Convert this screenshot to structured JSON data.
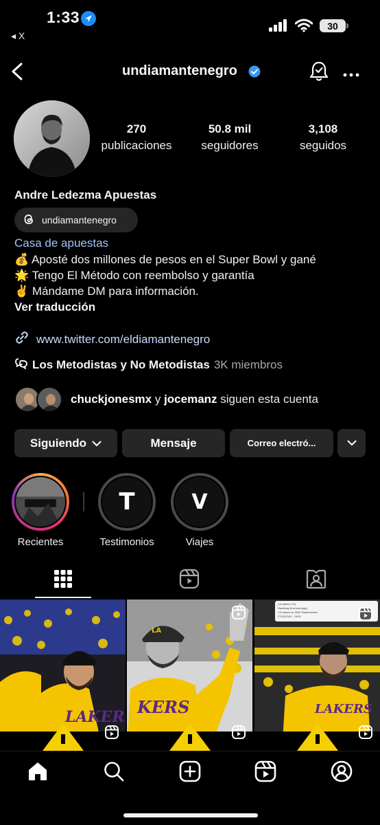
{
  "status_bar": {
    "time": "1:33",
    "back_app": "◂ X",
    "battery": "30"
  },
  "header": {
    "username": "undiamantenegro",
    "verified": true
  },
  "profile": {
    "stats": [
      {
        "value": "270",
        "label": "publicaciones"
      },
      {
        "value": "50.8 mil",
        "label": "seguidores"
      },
      {
        "value": "3,108",
        "label": "seguidos"
      }
    ],
    "full_name": "Andre Ledezma Apuestas",
    "threads_handle": "undiamantenegro",
    "category": "Casa de apuestas",
    "bio_lines": [
      "💰 Aposté dos millones de pesos en el Super Bowl y gané",
      "🌟 Tengo El Método con reembolso y garantía",
      "✌️ Mándame DM para información."
    ],
    "translate": "Ver traducción",
    "link": "www.twitter.com/eldiamantenegro",
    "channel_name": "Los Metodistas y No Metodistas",
    "channel_members": "3K miembros",
    "followed_by_1": "chuckjonesmx",
    "followed_by_and": " y ",
    "followed_by_2": "jocemanz",
    "followed_by_suffix": " siguen esta cuenta"
  },
  "buttons": {
    "following": "Siguiendo",
    "message": "Mensaje",
    "email": "Correo electró..."
  },
  "highlights": [
    {
      "label": "Recientes"
    },
    {
      "label": "Testimonios",
      "letter": "T"
    },
    {
      "label": "Viajes",
      "letter": "V"
    }
  ],
  "posts_grid_overlay_texts": {
    "tile3_caption_1": "LA Lakers (+5)",
    "tile3_caption_2": "Handicap (incl.prorroga)",
    "tile3_caption_3": "LA Lakers vs. MIN Timberwolves",
    "tile3_caption_4": "27/10/2024 · 19:00"
  },
  "colors": {
    "background": "#000000",
    "button_bg": "#262626",
    "link": "#c6dcfc",
    "verified": "#3897f0",
    "lakers_yellow": "#f5d000"
  },
  "icons": {
    "back": "chevron-left-icon",
    "bell": "bell-check-icon",
    "more": "more-horizontal-icon",
    "tabs": [
      "grid-icon",
      "reels-icon",
      "tagged-icon"
    ],
    "nav": [
      "home-icon",
      "search-icon",
      "create-icon",
      "reels-icon",
      "profile-icon"
    ]
  }
}
